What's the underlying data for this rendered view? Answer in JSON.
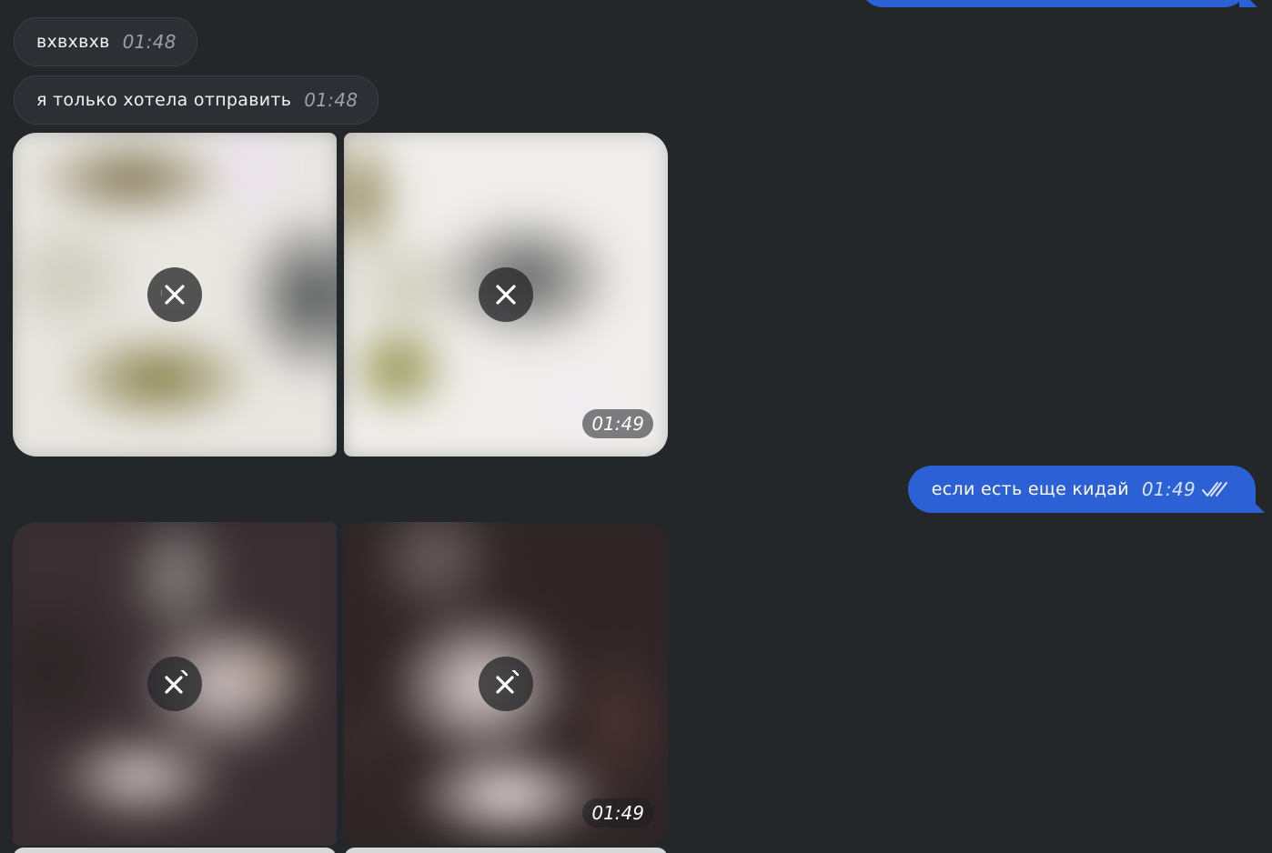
{
  "messages": {
    "in1": {
      "text": "вхвхвхв",
      "time": "01:48"
    },
    "in2": {
      "text": "я только хотела отправить",
      "time": "01:48"
    },
    "album1": {
      "time": "01:49"
    },
    "out1": {
      "text": "если есть еще кидай",
      "time": "01:49",
      "status": "read-double-check"
    },
    "album2": {
      "time": "01:49"
    }
  },
  "colors": {
    "background": "#242729",
    "incoming_bubble": "#2c2f33",
    "outgoing_bubble": "#2c61d6"
  },
  "icons": {
    "cancel_download": "close-x-icon",
    "read_status": "double-check-icon"
  }
}
